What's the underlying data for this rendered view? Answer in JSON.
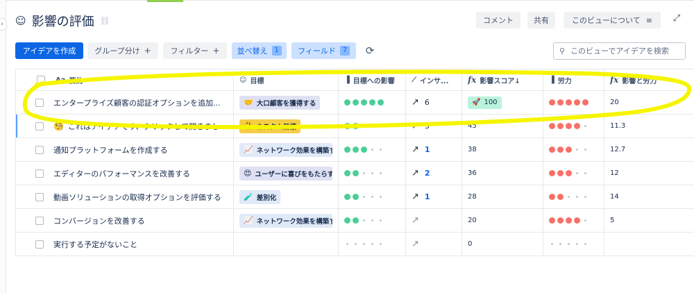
{
  "header": {
    "title_emoji": "☺",
    "title": "影響の評価",
    "buttons": {
      "comment": "コメント",
      "share": "共有",
      "about": "このビューについて"
    }
  },
  "toolbar": {
    "create": "アイデアを作成",
    "group": "グループ分け",
    "filter": "フィルター",
    "sort": "並べ替え",
    "sort_count": "1",
    "fields": "フィールド",
    "fields_count": "7",
    "search_placeholder": "このビューでアイデアを検索"
  },
  "columns": {
    "summary": {
      "icon": "Aa",
      "label": "要約"
    },
    "goal": {
      "icon": "☺",
      "label": "目標"
    },
    "goal_impact": {
      "icon": "▐",
      "label": "目標への影響"
    },
    "insights": {
      "icon": "⟋",
      "label": "インサ..."
    },
    "impact_score": {
      "icon": "fx",
      "label": "影響スコア↓"
    },
    "effort": {
      "icon": "▐",
      "label": "労力"
    },
    "impact_effort": {
      "icon": "fx",
      "label": "影響と労力"
    }
  },
  "rows": [
    {
      "emoji": "",
      "summary": "エンタープライズ顧客の認証オプションを追加...",
      "goal": {
        "icon": "🤝",
        "label": "大口顧客を獲得する",
        "style": "purple"
      },
      "goal_impact": 5,
      "insights": "6",
      "insights_link": false,
      "insights_muted": false,
      "score": "100",
      "score_icon": "🚀",
      "effort": 5,
      "impact_effort": "20"
    },
    {
      "emoji": "🧐",
      "summary": "これはアイデアです、クリックして開きまし...",
      "goal": {
        "icon": "🤔",
        "label": "カスタム目標",
        "style": "yellow"
      },
      "goal_impact": 2,
      "insights": "3",
      "insights_link": false,
      "insights_muted": false,
      "score": "45",
      "score_icon": "",
      "effort": 4,
      "impact_effort": "11.3"
    },
    {
      "emoji": "",
      "summary": "通知プラットフォームを作成する",
      "goal": {
        "icon": "📈",
        "label": "ネットワーク効果を構築す",
        "style": "blue"
      },
      "goal_impact": 3,
      "insights": "1",
      "insights_link": true,
      "insights_muted": false,
      "score": "38",
      "score_icon": "",
      "effort": 3,
      "impact_effort": "12.7"
    },
    {
      "emoji": "",
      "summary": "エディターのパフォーマンスを改善する",
      "goal": {
        "icon": "😍",
        "label": "ユーザーに喜びをもたらす",
        "style": "purple"
      },
      "goal_impact": 2,
      "insights": "2",
      "insights_link": true,
      "insights_muted": false,
      "score": "36",
      "score_icon": "",
      "effort": 3,
      "impact_effort": "12"
    },
    {
      "emoji": "",
      "summary": "動画ソリューションの取得オプションを評価する",
      "goal": {
        "icon": "🧪",
        "label": "差別化",
        "style": "blue"
      },
      "goal_impact": 2,
      "insights": "1",
      "insights_link": true,
      "insights_muted": false,
      "score": "28",
      "score_icon": "",
      "effort": 2,
      "impact_effort": "14"
    },
    {
      "emoji": "",
      "summary": "コンバージョンを改善する",
      "goal": {
        "icon": "📈",
        "label": "ネットワーク効果を構築す",
        "style": "blue"
      },
      "goal_impact": 2,
      "insights": "",
      "insights_link": false,
      "insights_muted": true,
      "score": "20",
      "score_icon": "",
      "effort": 4,
      "impact_effort": "5"
    },
    {
      "emoji": "",
      "summary": "実行する予定がないこと",
      "goal": null,
      "goal_impact": 0,
      "insights": "",
      "insights_link": false,
      "insights_muted": true,
      "score": "0",
      "score_icon": "",
      "effort": 0,
      "impact_effort": ""
    }
  ],
  "colors": {
    "primary": "#0c66e4",
    "impact_dot": "#4bce97",
    "effort_dot": "#f87168",
    "highlight": "#f5f500"
  }
}
